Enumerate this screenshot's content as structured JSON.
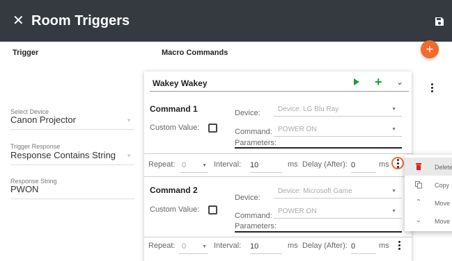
{
  "header": {
    "title": "Room Triggers",
    "close_icon": "close-icon",
    "save_icon": "save-icon"
  },
  "columns": {
    "trigger": "Trigger",
    "macro_commands": "Macro Commands"
  },
  "add_button": {
    "icon": "plus-icon",
    "color": "#f26b2b"
  },
  "trigger": {
    "select_device_label": "Select Device",
    "select_device_value": "Canon Projector",
    "trigger_response_label": "Trigger Response",
    "trigger_response_value": "Response Contains String",
    "response_string_label": "Response String",
    "response_string_value": "PWON"
  },
  "macro": {
    "name": "Wakey Wakey",
    "commands": [
      {
        "title": "Command 1",
        "device_label": "Device:",
        "device_value": "Device: LG Blu Ray",
        "custom_value_label": "Custom Value:",
        "command_label": "Command:",
        "command_value": "POWER ON",
        "parameters_label": "Parameters:",
        "repeat_label": "Repeat:",
        "repeat_value": "0",
        "interval_label": "Interval:",
        "interval_value": "10",
        "interval_unit": "ms",
        "delay_label": "Delay (After):",
        "delay_value": "0",
        "delay_unit": "ms"
      },
      {
        "title": "Command 2",
        "device_label": "Device:",
        "device_value": "Device: Microsoft Game",
        "custom_value_label": "Custom Value:",
        "command_label": "Command:",
        "command_value": "POWER ON",
        "parameters_label": "Parameters:",
        "repeat_label": "Repeat:",
        "repeat_value": "0",
        "interval_label": "Interval:",
        "interval_value": "10",
        "interval_unit": "ms",
        "delay_label": "Delay (After):",
        "delay_value": "0",
        "delay_unit": "ms"
      }
    ]
  },
  "context_menu": {
    "items": [
      {
        "label": "Delete",
        "icon": "trash-icon"
      },
      {
        "label": "Copy",
        "icon": "copy-icon"
      },
      {
        "label": "Move Up",
        "icon": "chevron-up-icon"
      },
      {
        "label": "Move Down",
        "icon": "chevron-down-icon"
      }
    ]
  },
  "colors": {
    "topbar": "#343a40",
    "accent": "#f26b2b",
    "green": "#1e9a3a",
    "delete_red": "#e0201b"
  }
}
